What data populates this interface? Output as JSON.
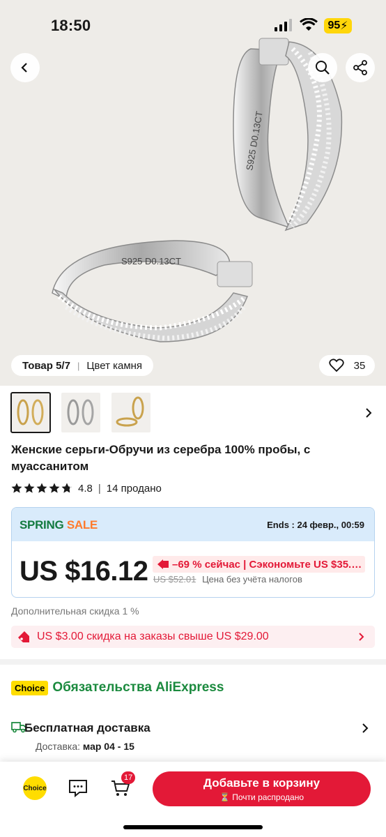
{
  "status_bar": {
    "time": "18:50",
    "battery": "95"
  },
  "gallery": {
    "position_label": "Товар 5/7",
    "variant_label": "Цвет камня",
    "engraving": "S925 D0.13CT",
    "favorites_count": "35"
  },
  "product": {
    "title": "Женские серьги-Обручи из серебра 100% пробы, с муассанитом",
    "rating": "4.8",
    "sold": "14 продано"
  },
  "promo": {
    "sale_word1": "SPRING",
    "sale_word2": " SALE",
    "ends": "Ends : 24 февр., 00:59",
    "price": "US $16.12",
    "discount": "–69 % сейчас | Сэкономьте US $35.…",
    "old_price": "US $52.01",
    "tax_note": "Цена без учёта налогов",
    "extra_discount": "Дополнительная скидка 1 %",
    "coupon": "US $3.00 скидка на заказы свыше US $29.00"
  },
  "choice": {
    "badge": "Choice",
    "title": "Обязательства AliExpress"
  },
  "shipping": {
    "title": "Бесплатная доставка",
    "date_label": "Доставка: ",
    "date_value": "мар 04 - 15"
  },
  "bottom_bar": {
    "choice_label": "Choice",
    "cart_count": "17",
    "add_to_cart": "Добавьте в корзину",
    "almost_sold": "Почти распродано"
  },
  "colors": {
    "accent_red": "#e31937",
    "choice_yellow": "#ffdd00",
    "spring_green": "#137a3f",
    "sale_orange": "#ff7b2c"
  }
}
